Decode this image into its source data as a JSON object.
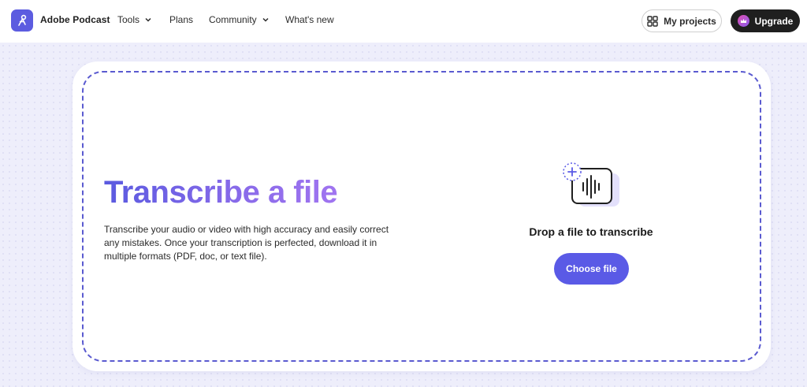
{
  "header": {
    "brand": "Adobe Podcast",
    "nav": [
      {
        "label": "Tools",
        "has_dropdown": true
      },
      {
        "label": "Plans",
        "has_dropdown": false
      },
      {
        "label": "Community",
        "has_dropdown": true
      },
      {
        "label": "What's new",
        "has_dropdown": false
      }
    ],
    "projects_label": "My projects",
    "upgrade_label": "Upgrade"
  },
  "hero": {
    "title": "Transcribe a file",
    "description": "Transcribe your audio or video with high accuracy and easily correct any mistakes. Once your transcription is perfected, download it in multiple formats (PDF, doc, or text file)."
  },
  "dropzone": {
    "icon": "audio-file-add-icon",
    "label": "Drop a file to transcribe",
    "button_label": "Choose file"
  },
  "colors": {
    "accent": "#5a5ae6",
    "brand_badge": "#5c5ce0",
    "background": "#eeeefb",
    "upgrade_bg": "#1f1f1f"
  }
}
